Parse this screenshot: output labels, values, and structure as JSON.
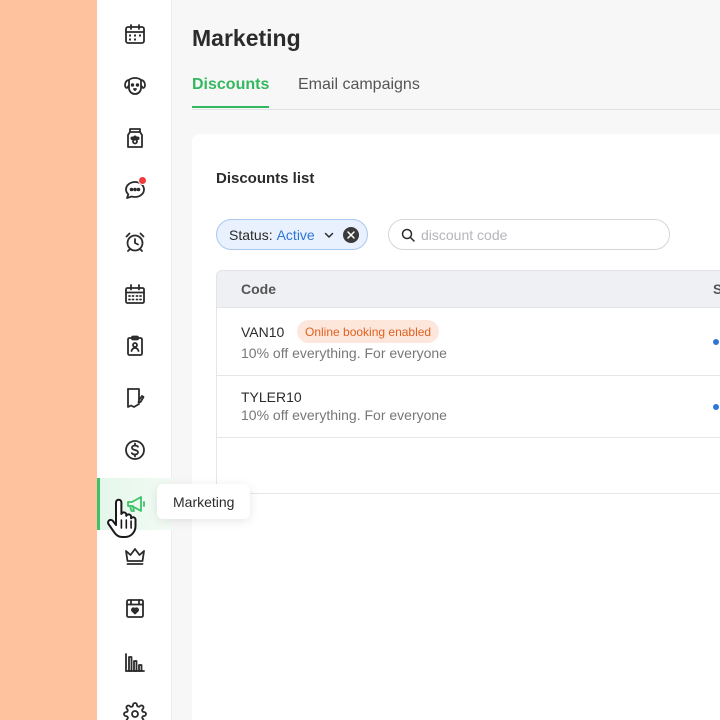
{
  "sidebar": {
    "items": [
      {
        "name": "calendar-icon",
        "active": false
      },
      {
        "name": "dog-icon",
        "active": false
      },
      {
        "name": "pet-food-icon",
        "active": false
      },
      {
        "name": "chat-icon",
        "active": false,
        "badge": true
      },
      {
        "name": "alarm-clock-icon",
        "active": false
      },
      {
        "name": "schedule-icon",
        "active": false
      },
      {
        "name": "clipboard-icon",
        "active": false
      },
      {
        "name": "document-icon",
        "active": false
      },
      {
        "name": "dollar-icon",
        "active": false
      },
      {
        "name": "megaphone-icon",
        "active": true
      },
      {
        "name": "crown-icon",
        "active": false
      },
      {
        "name": "gift-icon",
        "active": false
      },
      {
        "name": "bar-chart-icon",
        "active": false
      },
      {
        "name": "gear-icon",
        "active": false
      }
    ],
    "tooltip": "Marketing"
  },
  "page": {
    "title": "Marketing"
  },
  "tabs": [
    {
      "label": "Discounts",
      "active": true
    },
    {
      "label": "Email campaigns",
      "active": false
    }
  ],
  "card": {
    "title": "Discounts list"
  },
  "filter": {
    "label": "Status:",
    "value": "Active"
  },
  "search": {
    "placeholder": "discount code",
    "value": ""
  },
  "table": {
    "columns": [
      "Code",
      "S"
    ],
    "rows": [
      {
        "code": "VAN10",
        "tag": "Online booking enabled",
        "description": "10% off everything. For everyone"
      },
      {
        "code": "TYLER10",
        "tag": "",
        "description": "10% off everything. For everyone"
      }
    ]
  },
  "colors": {
    "accent": "#34b85e",
    "link": "#2f76d6",
    "tag_bg": "#fde7dd",
    "tag_text": "#e0611e",
    "badge": "#ef3b3b"
  }
}
